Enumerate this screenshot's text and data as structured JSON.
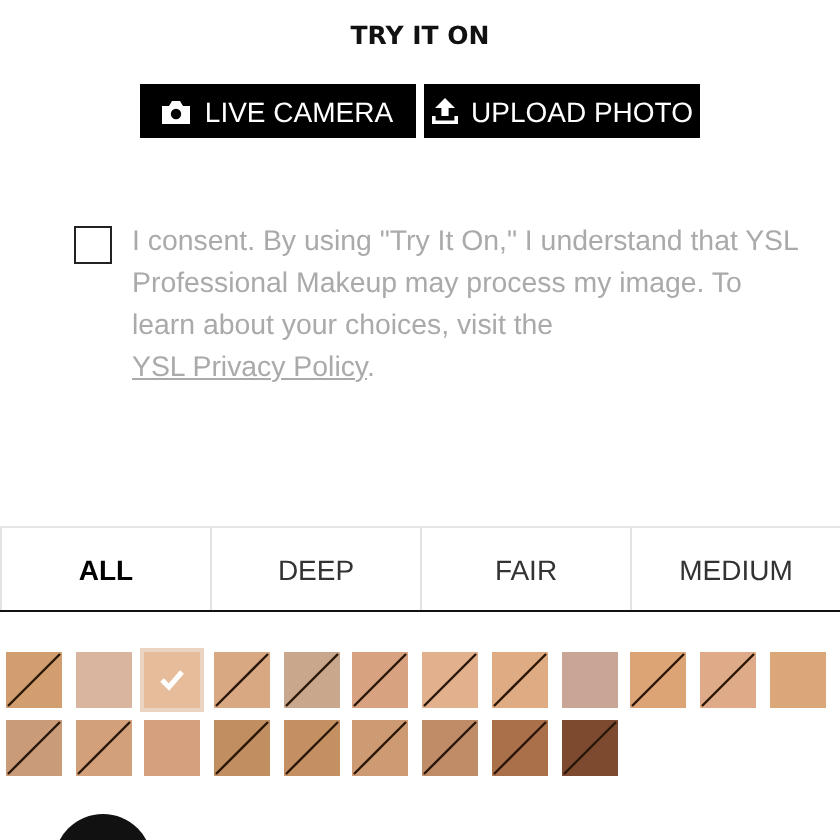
{
  "title": "TRY IT ON",
  "buttons": [
    {
      "kind": "camera",
      "label": "LIVE CAMERA"
    },
    {
      "kind": "upload",
      "label": "UPLOAD PHOTO"
    }
  ],
  "consent": {
    "checked": false,
    "text": "I consent. By using \"Try It On,\" I understand that YSL Professional Makeup may process my image. To learn about your choices, visit the ",
    "link": "YSL Privacy Policy",
    "end": "."
  },
  "tabs": [
    {
      "label": "ALL",
      "selected": true
    },
    {
      "label": "DEEP",
      "selected": false
    },
    {
      "label": "FAIR",
      "selected": false
    },
    {
      "label": "MEDIUM",
      "selected": false
    }
  ],
  "swatches": [
    {
      "color": "#d29e70",
      "unavailable": true,
      "selected": false
    },
    {
      "color": "#d9b5a0",
      "unavailable": false,
      "selected": false
    },
    {
      "color": "#e6bc9a",
      "unavailable": false,
      "selected": true
    },
    {
      "color": "#d8a882",
      "unavailable": true,
      "selected": false
    },
    {
      "color": "#c9a78c",
      "unavailable": true,
      "selected": false
    },
    {
      "color": "#d7a27f",
      "unavailable": true,
      "selected": false
    },
    {
      "color": "#e3b08e",
      "unavailable": true,
      "selected": false
    },
    {
      "color": "#dfab82",
      "unavailable": true,
      "selected": false
    },
    {
      "color": "#c9a595",
      "unavailable": false,
      "selected": false
    },
    {
      "color": "#dca474",
      "unavailable": true,
      "selected": false
    },
    {
      "color": "#dfaa87",
      "unavailable": true,
      "selected": false
    },
    {
      "color": "#dba678",
      "unavailable": false,
      "selected": false
    },
    {
      "color": "#c99b78",
      "unavailable": true,
      "selected": false
    },
    {
      "color": "#d2a07a",
      "unavailable": true,
      "selected": false
    },
    {
      "color": "#d4a07e",
      "unavailable": false,
      "selected": false
    },
    {
      "color": "#c08e60",
      "unavailable": true,
      "selected": false
    },
    {
      "color": "#c49062",
      "unavailable": true,
      "selected": false
    },
    {
      "color": "#cd9a74",
      "unavailable": true,
      "selected": false
    },
    {
      "color": "#c08c68",
      "unavailable": true,
      "selected": false
    },
    {
      "color": "#a9704a",
      "unavailable": true,
      "selected": false
    },
    {
      "color": "#7d4a30",
      "unavailable": true,
      "selected": false
    }
  ]
}
